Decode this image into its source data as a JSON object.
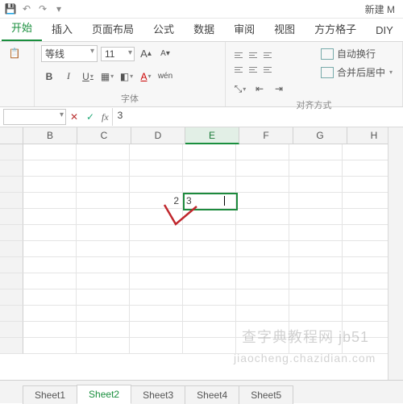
{
  "title": "新建 M",
  "qat": {
    "save": "💾",
    "undo": "↶",
    "redo": "↷",
    "more": "▾"
  },
  "tabs": [
    "开始",
    "插入",
    "页面布局",
    "公式",
    "数据",
    "审阅",
    "视图",
    "方方格子",
    "DIY"
  ],
  "activeTab": 0,
  "ribbon": {
    "font": {
      "name": "等线",
      "size": "11",
      "growA": "A",
      "shrinkA": "A",
      "bold": "B",
      "italic": "I",
      "underline": "U",
      "groupLabel": "字体"
    },
    "align": {
      "wrap": "自动换行",
      "merge": "合并后居中",
      "groupLabel": "对齐方式"
    }
  },
  "formulaBar": {
    "nameBox": "",
    "cancel": "✕",
    "confirm": "✓",
    "fx": "fx",
    "value": "3"
  },
  "columns": [
    "B",
    "C",
    "D",
    "E",
    "F",
    "G",
    "H"
  ],
  "activeCol": "E",
  "rows": 13,
  "cells": {
    "D4": "2",
    "E4": "3"
  },
  "activeCell": {
    "col": 4,
    "row": 4
  },
  "sheetTabs": [
    "Sheet1",
    "Sheet2",
    "Sheet3",
    "Sheet4",
    "Sheet5"
  ],
  "activeSheet": 1,
  "watermarks": {
    "a": "查字典教程网 jb51",
    "b": "jiaocheng.chazidian.com"
  }
}
